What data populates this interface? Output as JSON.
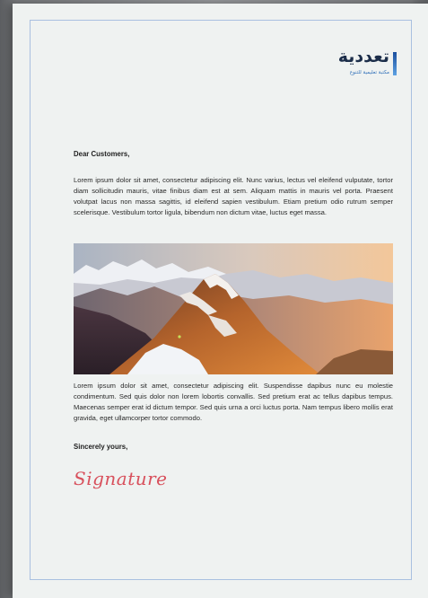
{
  "logo": {
    "name": "تعددية",
    "tagline": "مكتبة تعليمية للتنوع"
  },
  "letter": {
    "greeting": "Dear Customers,",
    "paragraph_1": "Lorem ipsum dolor sit amet, consectetur adipiscing elit. Nunc varius, lectus vel eleifend vulputate, tortor diam sollicitudin mauris, vitae finibus diam est at sem. Aliquam mattis in mauris vel porta. Praesent volutpat lacus non massa sagittis, id eleifend sapien vestibulum. Etiam pretium odio rutrum semper scelerisque. Vestibulum tortor ligula, bibendum non dictum vitae, luctus eget massa.",
    "paragraph_2": "Lorem ipsum dolor sit amet, consectetur adipiscing elit. Suspendisse dapibus nunc eu molestie condimentum. Sed quis dolor non lorem lobortis convallis. Sed pretium erat ac tellus dapibus tempus. Maecenas semper erat id dictum tempor.  Sed quis urna a orci luctus porta. Nam tempus libero mollis erat gravida, eget ullamcorper tortor commodo.",
    "closing": "Sincerely yours,",
    "signature": "Signature"
  },
  "colors": {
    "frame": "#a9c0e0",
    "signature": "#d8505c",
    "logo_accent": "#2f6fb8"
  }
}
